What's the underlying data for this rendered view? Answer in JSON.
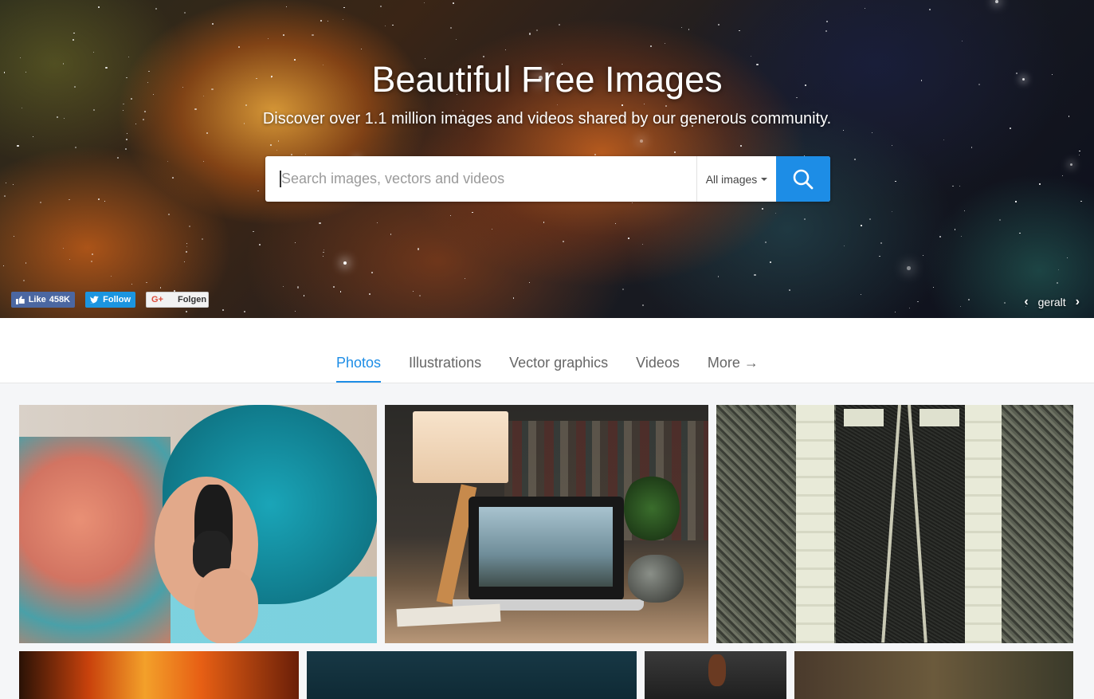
{
  "hero": {
    "title": "Beautiful Free Images",
    "subtitle": "Discover over 1.1 million images and videos shared by our generous community.",
    "credit_author": "geralt",
    "credit_prev_icon": "‹",
    "credit_next_icon": "›"
  },
  "search": {
    "placeholder": "Search images, vectors and videos",
    "value": "",
    "type_selected": "All images",
    "button_icon": "search-icon"
  },
  "social": {
    "facebook": {
      "label": "Like",
      "count": "458K"
    },
    "twitter": {
      "label": "Follow"
    },
    "google": {
      "label": "Folgen",
      "glyph": "G+"
    }
  },
  "tabs": [
    {
      "label": "Photos",
      "active": true
    },
    {
      "label": "Illustrations",
      "active": false
    },
    {
      "label": "Vector graphics",
      "active": false
    },
    {
      "label": "Videos",
      "active": false
    },
    {
      "label": "More →",
      "active": false
    }
  ],
  "colors": {
    "accent": "#1d8de6",
    "facebook": "#4b67a1",
    "twitter": "#1b95e0"
  }
}
